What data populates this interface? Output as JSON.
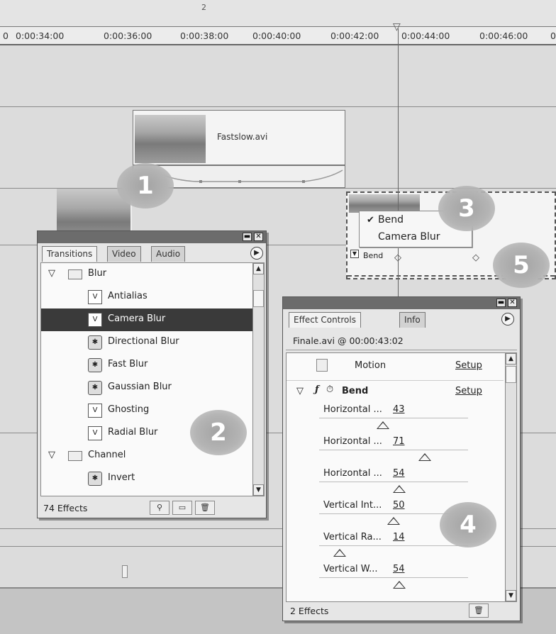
{
  "timeline": {
    "marker_label": "2",
    "ruler_labels": [
      "0",
      "0:00:34:00",
      "0:00:36:00",
      "0:00:38:00",
      "0:00:40:00",
      "0:00:42:00",
      "0:00:44:00",
      "0:00:46:00",
      "0"
    ],
    "clip1_name": "Fastslow.avi"
  },
  "callouts": [
    "1",
    "2",
    "3",
    "4",
    "5"
  ],
  "context_menu": {
    "items": [
      "Bend",
      "Camera Blur"
    ],
    "checked_item": "Bend",
    "clip_effect_label": "Bend"
  },
  "transitions_palette": {
    "tabs": [
      "Transitions",
      "Video",
      "Audio"
    ],
    "active_tab": "Transitions",
    "folders": [
      {
        "name": "Blur",
        "items": [
          "Antialias",
          "Camera Blur",
          "Directional Blur",
          "Fast Blur",
          "Gaussian Blur",
          "Ghosting",
          "Radial Blur"
        ]
      },
      {
        "name": "Channel",
        "items": [
          "Invert"
        ]
      }
    ],
    "selected_item": "Camera Blur",
    "status": "74 Effects"
  },
  "effect_controls": {
    "tabs": [
      "Effect Controls",
      "Info"
    ],
    "active_tab": "Effect Controls",
    "header": "Finale.avi @ 00:00:43:02",
    "motion_label": "Motion",
    "setup_label": "Setup",
    "effect_name": "Bend",
    "params": [
      {
        "name": "Horizontal ...",
        "value": "43",
        "pct": 0.43
      },
      {
        "name": "Horizontal ...",
        "value": "71",
        "pct": 0.71
      },
      {
        "name": "Horizontal ...",
        "value": "54",
        "pct": 0.54
      },
      {
        "name": "Vertical Int...",
        "value": "50",
        "pct": 0.5
      },
      {
        "name": "Vertical Ra...",
        "value": "14",
        "pct": 0.14
      },
      {
        "name": "Vertical W...",
        "value": "54",
        "pct": 0.54
      }
    ],
    "status": "2 Effects"
  }
}
